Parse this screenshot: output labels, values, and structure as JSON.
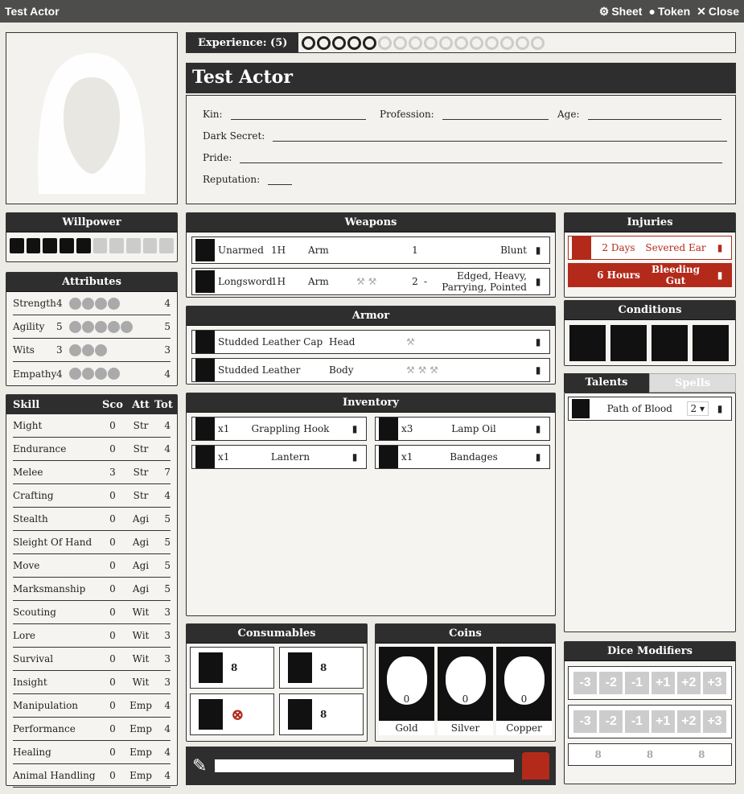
{
  "window": {
    "title": "Test Actor",
    "sheet_label": "Sheet",
    "token_label": "Token",
    "close_label": "Close"
  },
  "experience": {
    "label": "Experience: (5)",
    "filled": 5,
    "total": 16
  },
  "actor_name": "Test Actor",
  "bio": {
    "kin_label": "Kin:",
    "profession_label": "Profession:",
    "age_label": "Age:",
    "dark_secret_label": "Dark Secret:",
    "pride_label": "Pride:",
    "reputation_label": "Reputation:"
  },
  "willpower": {
    "title": "Willpower",
    "filled": 5,
    "total": 10
  },
  "attributes": {
    "title": "Attributes",
    "items": [
      {
        "name": "Strength",
        "value": "4",
        "max": "4",
        "skulls": 4
      },
      {
        "name": "Agility",
        "value": "5",
        "max": "5",
        "skulls": 5
      },
      {
        "name": "Wits",
        "value": "3",
        "max": "3",
        "skulls": 3
      },
      {
        "name": "Empathy",
        "value": "4",
        "max": "4",
        "skulls": 4
      }
    ]
  },
  "skills": {
    "headers": [
      "Skill",
      "Sco",
      "Att",
      "Tot"
    ],
    "items": [
      {
        "name": "Might",
        "score": "0",
        "attr": "Str",
        "total": "4"
      },
      {
        "name": "Endurance",
        "score": "0",
        "attr": "Str",
        "total": "4"
      },
      {
        "name": "Melee",
        "score": "3",
        "attr": "Str",
        "total": "7"
      },
      {
        "name": "Crafting",
        "score": "0",
        "attr": "Str",
        "total": "4"
      },
      {
        "name": "Stealth",
        "score": "0",
        "attr": "Agi",
        "total": "5"
      },
      {
        "name": "Sleight Of Hand",
        "score": "0",
        "attr": "Agi",
        "total": "5"
      },
      {
        "name": "Move",
        "score": "0",
        "attr": "Agi",
        "total": "5"
      },
      {
        "name": "Marksmanship",
        "score": "0",
        "attr": "Agi",
        "total": "5"
      },
      {
        "name": "Scouting",
        "score": "0",
        "attr": "Wit",
        "total": "3"
      },
      {
        "name": "Lore",
        "score": "0",
        "attr": "Wit",
        "total": "3"
      },
      {
        "name": "Survival",
        "score": "0",
        "attr": "Wit",
        "total": "3"
      },
      {
        "name": "Insight",
        "score": "0",
        "attr": "Wit",
        "total": "3"
      },
      {
        "name": "Manipulation",
        "score": "0",
        "attr": "Emp",
        "total": "4"
      },
      {
        "name": "Performance",
        "score": "0",
        "attr": "Emp",
        "total": "4"
      },
      {
        "name": "Healing",
        "score": "0",
        "attr": "Emp",
        "total": "4"
      },
      {
        "name": "Animal Handling",
        "score": "0",
        "attr": "Emp",
        "total": "4"
      }
    ]
  },
  "weapons": {
    "title": "Weapons",
    "items": [
      {
        "name": "Unarmed",
        "hands": "1H",
        "loc": "Arm",
        "bonus": "1",
        "dash": "",
        "features": "Blunt"
      },
      {
        "name": "Longsword",
        "hands": "1H",
        "loc": "Arm",
        "bonus": "2",
        "dash": "-",
        "features": "Edged, Heavy, Parrying, Pointed"
      }
    ]
  },
  "armor": {
    "title": "Armor",
    "items": [
      {
        "name": "Studded Leather Cap",
        "loc": "Head"
      },
      {
        "name": "Studded Leather",
        "loc": "Body"
      }
    ]
  },
  "inventory": {
    "title": "Inventory",
    "items": [
      {
        "qty": "x1",
        "name": "Grappling Hook"
      },
      {
        "qty": "x3",
        "name": "Lamp Oil"
      },
      {
        "qty": "x1",
        "name": "Lantern"
      },
      {
        "qty": "x1",
        "name": "Bandages"
      }
    ]
  },
  "consumables": {
    "title": "Consumables",
    "die": "8"
  },
  "coins": {
    "title": "Coins",
    "items": [
      {
        "label": "Gold",
        "value": "0"
      },
      {
        "label": "Silver",
        "value": "0"
      },
      {
        "label": "Copper",
        "value": "0"
      }
    ]
  },
  "injuries": {
    "title": "Injuries",
    "items": [
      {
        "time": "2 Days",
        "name": "Severed Ear"
      },
      {
        "time": "6 Hours",
        "name": "Bleeding Gut"
      }
    ]
  },
  "conditions": {
    "title": "Conditions"
  },
  "tabs": {
    "talents": "Talents",
    "spells": "Spells"
  },
  "talents": {
    "items": [
      {
        "name": "Path of Blood",
        "rank": "2"
      }
    ]
  },
  "dice_modifiers": {
    "title": "Dice Modifiers",
    "values": [
      "-3",
      "-2",
      "-1",
      "+1",
      "+2",
      "+3"
    ],
    "die": "8"
  }
}
